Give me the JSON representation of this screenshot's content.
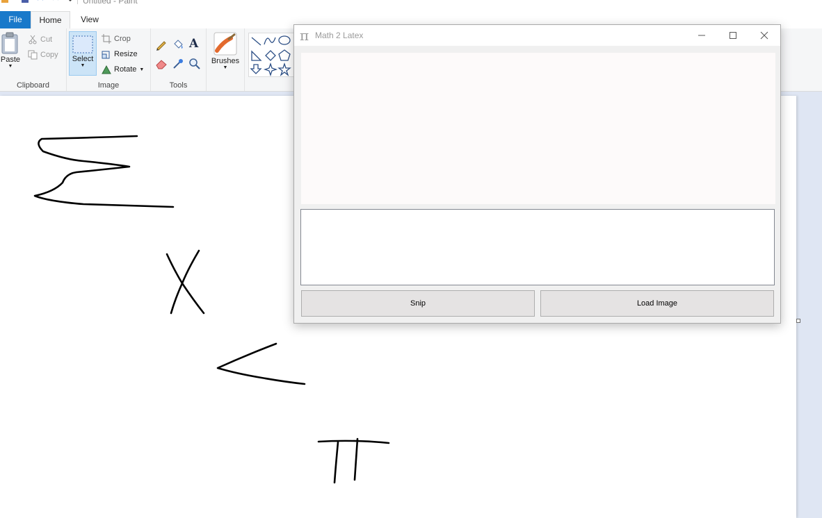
{
  "window": {
    "title": "Untitled - Paint"
  },
  "ribbon": {
    "tabs": [
      "File",
      "Home",
      "View"
    ],
    "clipboard": {
      "paste": "Paste",
      "cut": "Cut",
      "copy": "Copy",
      "label": "Clipboard"
    },
    "image": {
      "select": "Select",
      "crop": "Crop",
      "resize": "Resize",
      "rotate": "Rotate",
      "label": "Image"
    },
    "tools": {
      "label": "Tools"
    },
    "brushes": {
      "label": "Brushes"
    }
  },
  "dialog": {
    "title": "Math 2 Latex",
    "icon": "π",
    "latex_value": "",
    "snip_label": "Snip",
    "load_label": "Load Image"
  },
  "colors": {
    "file_tab": "#1979ca",
    "ribbon_bg": "#f5f6f7",
    "canvas_bg": "#dfe6f3",
    "button_bg": "#e5e3e3"
  }
}
